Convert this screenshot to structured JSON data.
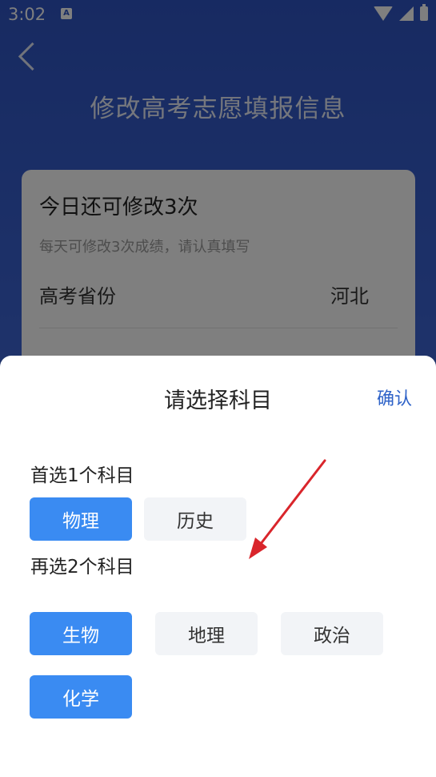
{
  "status_bar": {
    "time": "3:02",
    "notification_icon": "A"
  },
  "header": {
    "title": "修改高考志愿填报信息"
  },
  "card": {
    "remaining": "今日还可修改3次",
    "hint": "每天可修改3次成绩，请认真填写",
    "province_label": "高考省份",
    "province_value": "河北"
  },
  "sheet": {
    "title": "请选择科目",
    "confirm_label": "确认",
    "first_section_label": "首选1个科目",
    "first_options": [
      {
        "label": "物理",
        "selected": true
      },
      {
        "label": "历史",
        "selected": false
      }
    ],
    "second_section_label": "再选2个科目",
    "second_options": [
      {
        "label": "生物",
        "selected": true
      },
      {
        "label": "地理",
        "selected": false
      },
      {
        "label": "政治",
        "selected": false
      },
      {
        "label": "化学",
        "selected": true
      }
    ]
  },
  "colors": {
    "accent": "#3a8bf2",
    "header_bg": "#2f55c4",
    "annotation_arrow": "#d9252b"
  }
}
